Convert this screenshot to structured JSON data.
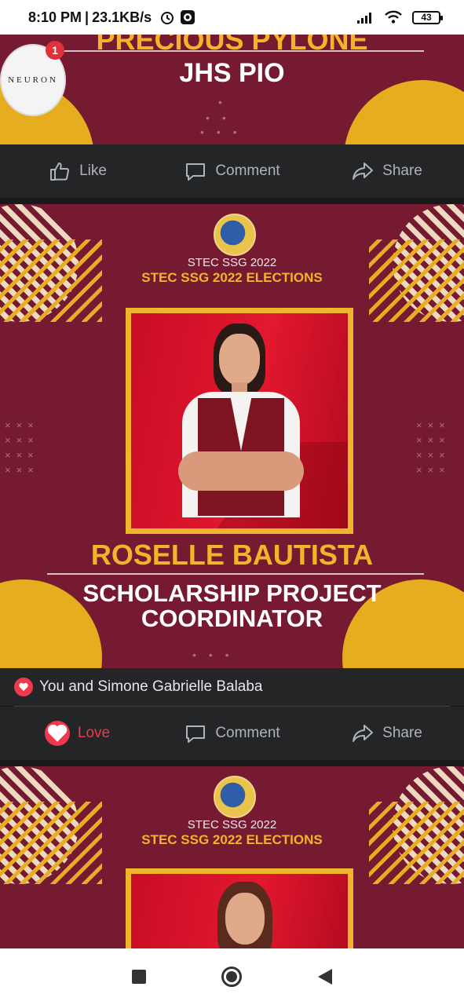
{
  "status_bar": {
    "time": "8:10 PM",
    "speed": "23.1KB/s",
    "battery": "43"
  },
  "chat_head": {
    "label": "NEURON",
    "badge_count": "1"
  },
  "post1": {
    "name": "PRECIOUS PYLONE",
    "role": "JHS PIO",
    "actions": {
      "like": "Like",
      "comment": "Comment",
      "share": "Share"
    }
  },
  "post2": {
    "org": "STEC SSG 2022",
    "elections": "STEC SSG 2022 ELECTIONS",
    "name": "ROSELLE BAUTISTA",
    "role_line1": "SCHOLARSHIP PROJECT",
    "role_line2": "COORDINATOR",
    "reactions_text": "You and Simone Gabrielle Balaba",
    "actions": {
      "love": "Love",
      "comment": "Comment",
      "share": "Share"
    }
  },
  "post3": {
    "org": "STEC SSG 2022",
    "elections": "STEC SSG 2022 ELECTIONS"
  },
  "colors": {
    "maroon": "#761a31",
    "gold": "#e6ad1f",
    "love": "#f0394f",
    "action_bar": "#242526"
  }
}
